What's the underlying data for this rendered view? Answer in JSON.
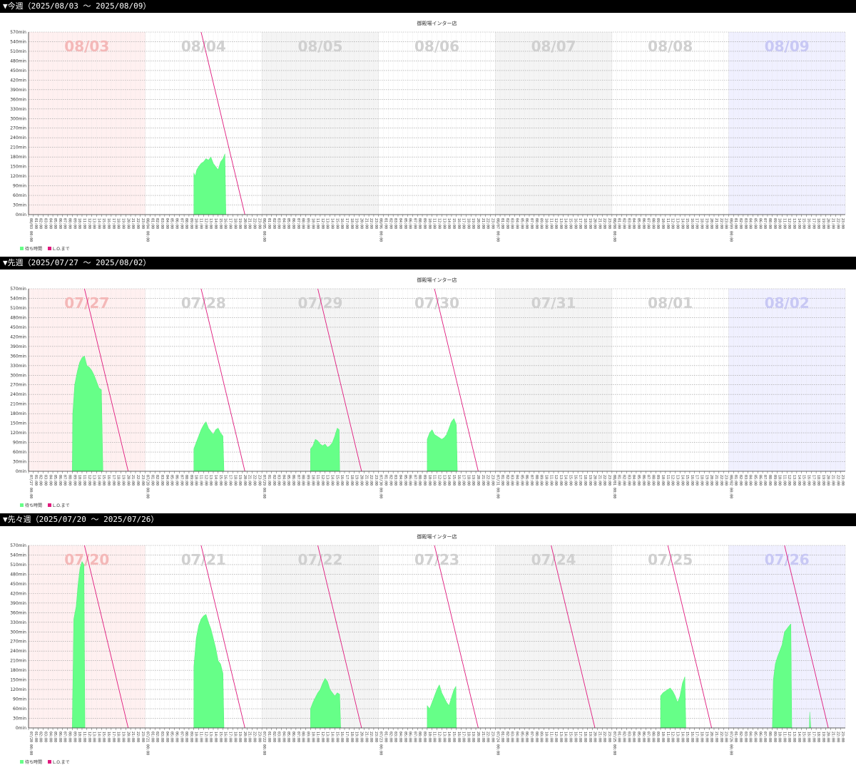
{
  "legend": {
    "wait_label": "待ち時間",
    "lo_label": "L.O.まで",
    "wait_color": "#66ff88",
    "lo_color": "#e0197d"
  },
  "colors": {
    "sun_band": "#fff0f0",
    "sat_band": "#f0f0ff",
    "alt_band": "#f4f4f4",
    "sun_text": "#f4b8b8",
    "sat_text": "#c8c8f4",
    "day_text": "#d0d0d0"
  },
  "weeks": [
    {
      "header": "▼今週（2025/08/03 〜 2025/08/09）",
      "chart_data": {
        "type": "area",
        "title": "御殿場インター店",
        "ylim": [
          0,
          570
        ],
        "ytick_step": 30,
        "ytick_suffix": "min",
        "days": [
          "08/03",
          "08/04",
          "08/05",
          "08/06",
          "08/07",
          "08/08",
          "08/09"
        ],
        "day_ticks": [
          "08/03 00:00",
          "08/04 00:00",
          "08/05 00:00",
          "08/06 00:00",
          "08/07 00:00",
          "08/08 00:00",
          "08/09 00:00"
        ],
        "series": [
          {
            "name": "待ち時間",
            "values": [
              [],
              [
                [
                  10.0,
                  130
                ],
                [
                  10.3,
                  120
                ],
                [
                  10.6,
                  140
                ],
                [
                  11.0,
                  150
                ],
                [
                  11.5,
                  160
                ],
                [
                  12.0,
                  165
                ],
                [
                  12.5,
                  175
                ],
                [
                  13.0,
                  170
                ],
                [
                  13.5,
                  180
                ],
                [
                  14.0,
                  160
                ],
                [
                  14.5,
                  150
                ],
                [
                  15.0,
                  140
                ],
                [
                  15.5,
                  165
                ],
                [
                  16.0,
                  175
                ],
                [
                  16.4,
                  190
                ],
                [
                  16.6,
                  0
                ]
              ],
              [],
              [],
              [],
              [],
              []
            ]
          },
          {
            "name": "L.O.まで",
            "lines": [
              [],
              [
                [
                  11.5,
                  570
                ],
                [
                  20.5,
                  0
                ]
              ],
              [],
              [],
              [],
              [],
              []
            ]
          }
        ]
      }
    },
    {
      "header": "▼先週（2025/07/27 〜 2025/08/02）",
      "chart_data": {
        "type": "area",
        "title": "御殿場インター店",
        "ylim": [
          0,
          570
        ],
        "ytick_step": 30,
        "ytick_suffix": "min",
        "days": [
          "07/27",
          "07/28",
          "07/29",
          "07/30",
          "07/31",
          "08/01",
          "08/02"
        ],
        "day_ticks": [
          "07/27 00:00",
          "07/28 00:00",
          "07/29 00:00",
          "07/30 00:00",
          "07/31 00:00",
          "08/01 00:00",
          "08/02 00:00"
        ],
        "series": [
          {
            "name": "待ち時間",
            "values": [
              [
                [
                  9.0,
                  0
                ],
                [
                  9.1,
                  180
                ],
                [
                  9.5,
                  270
                ],
                [
                  10.0,
                  310
                ],
                [
                  10.5,
                  340
                ],
                [
                  11.0,
                  355
                ],
                [
                  11.5,
                  360
                ],
                [
                  12.0,
                  330
                ],
                [
                  12.5,
                  325
                ],
                [
                  13.0,
                  315
                ],
                [
                  13.5,
                  300
                ],
                [
                  14.0,
                  280
                ],
                [
                  14.5,
                  260
                ],
                [
                  15.0,
                  255
                ],
                [
                  15.3,
                  0
                ]
              ],
              [
                [
                  10.0,
                  70
                ],
                [
                  10.5,
                  90
                ],
                [
                  11.0,
                  110
                ],
                [
                  11.5,
                  130
                ],
                [
                  12.0,
                  145
                ],
                [
                  12.5,
                  155
                ],
                [
                  13.0,
                  135
                ],
                [
                  13.5,
                  125
                ],
                [
                  14.0,
                  115
                ],
                [
                  14.5,
                  130
                ],
                [
                  15.0,
                  135
                ],
                [
                  15.5,
                  120
                ],
                [
                  16.0,
                  110
                ],
                [
                  16.2,
                  0
                ]
              ],
              [
                [
                  10.0,
                  70
                ],
                [
                  10.5,
                  80
                ],
                [
                  11.0,
                  100
                ],
                [
                  11.5,
                  95
                ],
                [
                  12.0,
                  85
                ],
                [
                  12.5,
                  80
                ],
                [
                  13.0,
                  85
                ],
                [
                  13.5,
                  75
                ],
                [
                  14.0,
                  80
                ],
                [
                  14.5,
                  90
                ],
                [
                  15.0,
                  110
                ],
                [
                  15.5,
                  135
                ],
                [
                  15.9,
                  130
                ],
                [
                  16.0,
                  0
                ]
              ],
              [
                [
                  10.0,
                  100
                ],
                [
                  10.5,
                  120
                ],
                [
                  11.0,
                  130
                ],
                [
                  11.5,
                  115
                ],
                [
                  12.0,
                  110
                ],
                [
                  12.5,
                  105
                ],
                [
                  13.0,
                  100
                ],
                [
                  13.5,
                  105
                ],
                [
                  14.0,
                  115
                ],
                [
                  14.5,
                  135
                ],
                [
                  15.0,
                  155
                ],
                [
                  15.5,
                  165
                ],
                [
                  16.0,
                  145
                ],
                [
                  16.2,
                  0
                ]
              ],
              [],
              [],
              []
            ]
          },
          {
            "name": "L.O.まで",
            "lines": [
              [
                [
                  11.5,
                  570
                ],
                [
                  20.5,
                  0
                ]
              ],
              [
                [
                  11.5,
                  570
                ],
                [
                  20.5,
                  0
                ]
              ],
              [
                [
                  11.5,
                  570
                ],
                [
                  20.5,
                  0
                ]
              ],
              [
                [
                  11.5,
                  570
                ],
                [
                  20.5,
                  0
                ]
              ],
              [],
              [],
              []
            ]
          }
        ]
      }
    },
    {
      "header": "▼先々週（2025/07/20 〜 2025/07/26）",
      "chart_data": {
        "type": "area",
        "title": "御殿場インター店",
        "ylim": [
          0,
          570
        ],
        "ytick_step": 30,
        "ytick_suffix": "min",
        "days": [
          "07/20",
          "07/21",
          "07/22",
          "07/23",
          "07/24",
          "07/25",
          "07/26"
        ],
        "day_ticks": [
          "07/20 00:00",
          "07/21 00:00",
          "07/22 00:00",
          "07/23 00:00",
          "07/24 00:00",
          "07/25 00:00",
          "07/26 00:00"
        ],
        "series": [
          {
            "name": "待ち時間",
            "values": [
              [
                [
                  9.0,
                  0
                ],
                [
                  9.3,
                  340
                ],
                [
                  9.8,
                  380
                ],
                [
                  10.2,
                  450
                ],
                [
                  10.6,
                  500
                ],
                [
                  11.0,
                  520
                ],
                [
                  11.4,
                  510
                ],
                [
                  11.6,
                  0
                ]
              ],
              [
                [
                  10.0,
                  190
                ],
                [
                  10.5,
                  280
                ],
                [
                  11.0,
                  320
                ],
                [
                  11.5,
                  340
                ],
                [
                  12.0,
                  350
                ],
                [
                  12.5,
                  355
                ],
                [
                  13.0,
                  330
                ],
                [
                  13.5,
                  310
                ],
                [
                  14.0,
                  280
                ],
                [
                  14.5,
                  250
                ],
                [
                  15.0,
                  210
                ],
                [
                  15.5,
                  200
                ],
                [
                  16.0,
                  170
                ],
                [
                  16.2,
                  0
                ]
              ],
              [
                [
                  10.0,
                  60
                ],
                [
                  10.5,
                  80
                ],
                [
                  11.0,
                  95
                ],
                [
                  11.5,
                  110
                ],
                [
                  12.0,
                  120
                ],
                [
                  12.5,
                  140
                ],
                [
                  13.0,
                  155
                ],
                [
                  13.5,
                  145
                ],
                [
                  14.0,
                  120
                ],
                [
                  14.5,
                  110
                ],
                [
                  15.0,
                  100
                ],
                [
                  15.5,
                  110
                ],
                [
                  16.0,
                  105
                ],
                [
                  16.2,
                  0
                ]
              ],
              [
                [
                  10.0,
                  70
                ],
                [
                  10.5,
                  60
                ],
                [
                  11.0,
                  80
                ],
                [
                  11.5,
                  100
                ],
                [
                  12.0,
                  120
                ],
                [
                  12.5,
                  135
                ],
                [
                  13.0,
                  110
                ],
                [
                  13.5,
                  95
                ],
                [
                  14.0,
                  80
                ],
                [
                  14.5,
                  70
                ],
                [
                  15.0,
                  95
                ],
                [
                  15.5,
                  120
                ],
                [
                  15.9,
                  130
                ],
                [
                  16.0,
                  0
                ]
              ],
              [],
              [
                [
                  10.0,
                  100
                ],
                [
                  10.5,
                  110
                ],
                [
                  11.0,
                  115
                ],
                [
                  11.5,
                  120
                ],
                [
                  12.0,
                  125
                ],
                [
                  12.5,
                  115
                ],
                [
                  13.0,
                  100
                ],
                [
                  13.5,
                  80
                ],
                [
                  14.0,
                  100
                ],
                [
                  14.5,
                  140
                ],
                [
                  15.0,
                  160
                ],
                [
                  15.2,
                  0
                ]
              ],
              [
                [
                  9.0,
                  0
                ],
                [
                  9.2,
                  150
                ],
                [
                  9.6,
                  200
                ],
                [
                  10.0,
                  220
                ],
                [
                  10.5,
                  240
                ],
                [
                  11.0,
                  260
                ],
                [
                  11.5,
                  300
                ],
                [
                  12.0,
                  310
                ],
                [
                  12.5,
                  320
                ],
                [
                  12.8,
                  325
                ],
                [
                  13.0,
                  0
                ],
                [
                  16.6,
                  0
                ],
                [
                  16.7,
                  50
                ],
                [
                  16.9,
                  0
                ]
              ]
            ]
          },
          {
            "name": "L.O.まで",
            "lines": [
              [
                [
                  11.5,
                  570
                ],
                [
                  20.5,
                  0
                ]
              ],
              [
                [
                  11.5,
                  570
                ],
                [
                  20.5,
                  0
                ]
              ],
              [
                [
                  11.5,
                  570
                ],
                [
                  20.5,
                  0
                ]
              ],
              [
                [
                  11.5,
                  570
                ],
                [
                  20.5,
                  0
                ]
              ],
              [
                [
                  11.5,
                  570
                ],
                [
                  20.5,
                  0
                ]
              ],
              [
                [
                  11.5,
                  570
                ],
                [
                  20.5,
                  0
                ]
              ],
              [
                [
                  11.5,
                  570
                ],
                [
                  20.5,
                  0
                ]
              ]
            ]
          }
        ]
      }
    }
  ]
}
